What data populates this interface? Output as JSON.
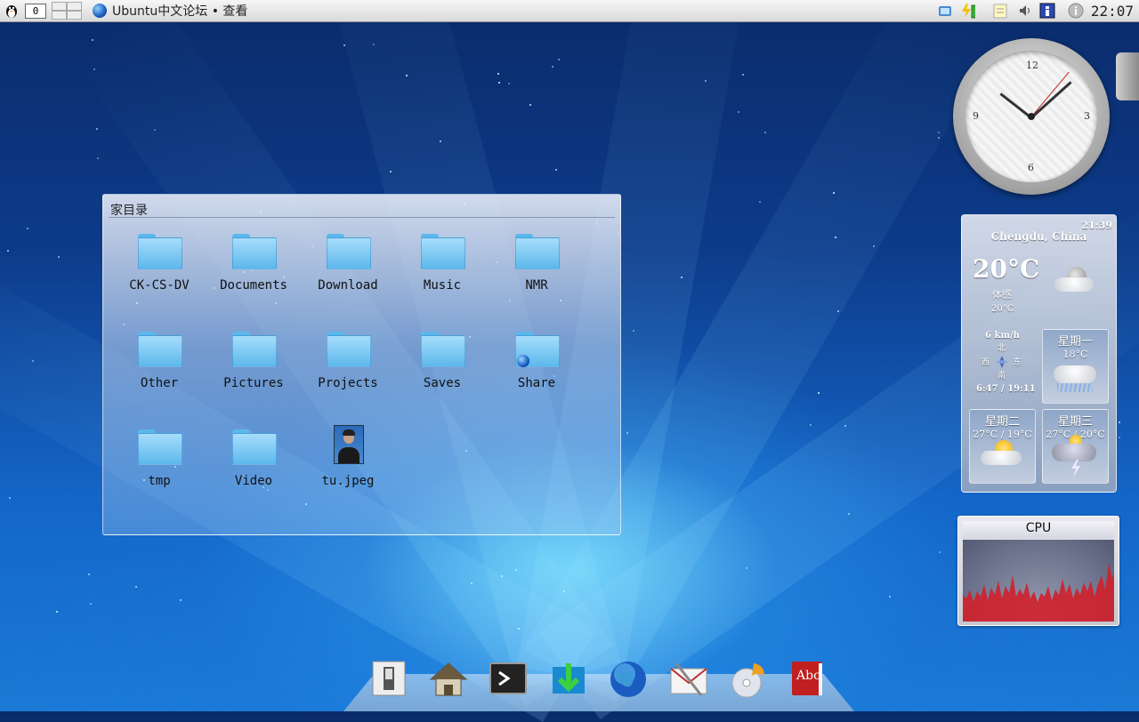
{
  "panel": {
    "desktop_number": "0",
    "task_title": "Ubuntu中文论坛 • 查看",
    "clock": "22:07"
  },
  "folder_view": {
    "title": "家目录",
    "items": [
      {
        "label": "CK-CS-DV",
        "kind": "folder"
      },
      {
        "label": "Documents",
        "kind": "folder"
      },
      {
        "label": "Download",
        "kind": "folder"
      },
      {
        "label": "Music",
        "kind": "folder"
      },
      {
        "label": "NMR",
        "kind": "folder"
      },
      {
        "label": "Other",
        "kind": "folder"
      },
      {
        "label": "Pictures",
        "kind": "folder"
      },
      {
        "label": "Projects",
        "kind": "folder"
      },
      {
        "label": "Saves",
        "kind": "folder"
      },
      {
        "label": "Share",
        "kind": "shared-folder"
      },
      {
        "label": "tmp",
        "kind": "folder"
      },
      {
        "label": "Video",
        "kind": "folder"
      },
      {
        "label": "tu.jpeg",
        "kind": "image"
      }
    ]
  },
  "analog_clock": {
    "numerals": [
      "12",
      "3",
      "6",
      "9"
    ]
  },
  "weather": {
    "time": "21:39",
    "location": "Chengdu, China",
    "temperature": "20°C",
    "feels_label": "体感",
    "feels_value": "20°C",
    "wind_speed": "6 km/h",
    "dir_north": "北",
    "dir_west": "西",
    "dir_east": "东",
    "dir_south": "南",
    "sun_times": "6:47 / 19:11",
    "forecast": [
      {
        "day": "星期一",
        "temps": "18°C",
        "icon": "rain-cloud-icon"
      },
      {
        "day": "星期二",
        "temps": "27°C / 19°C",
        "icon": "sun-cloud-icon"
      },
      {
        "day": "星期三",
        "temps": "27°C / 20°C",
        "icon": "thunderstorm-icon"
      }
    ]
  },
  "cpu": {
    "title": "CPU"
  },
  "dock": {
    "items": [
      "switch-icon",
      "home-icon",
      "terminal-icon",
      "download-icon",
      "globe-icon",
      "mail-icon",
      "media-disc-icon",
      "dictionary-icon"
    ],
    "dictionary_text": "Abc"
  },
  "colors": {
    "folder": "#5cb8ec",
    "cpu_graph": "#d0202a",
    "desktop_glow": "#2ad6ff"
  }
}
